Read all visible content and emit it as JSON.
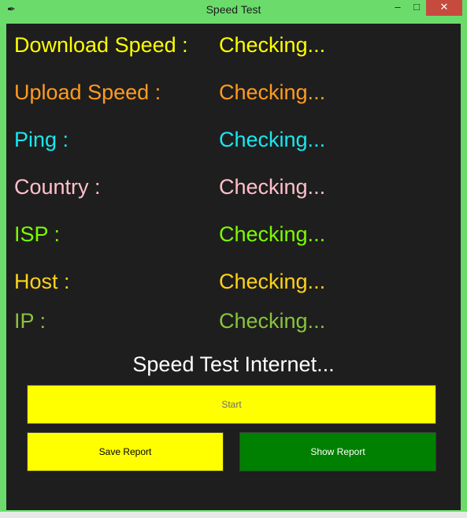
{
  "window": {
    "title": "Speed Test",
    "icon": "feather-icon",
    "minimize_glyph": "–",
    "maximize_glyph": "□",
    "close_glyph": "✕"
  },
  "rows": [
    {
      "label": "Download Speed :",
      "value": "Checking...",
      "color": "#ffff00"
    },
    {
      "label": "Upload Speed :",
      "value": "Checking...",
      "color": "#ff9b21"
    },
    {
      "label": "Ping :",
      "value": "Checking...",
      "color": "#1ae6ee"
    },
    {
      "label": "Country :",
      "value": "Checking...",
      "color": "#ffc0cb"
    },
    {
      "label": "ISP :",
      "value": "Checking...",
      "color": "#7cfc00"
    },
    {
      "label": "Host :",
      "value": "Checking...",
      "color": "#ffd21a"
    },
    {
      "label": "IP :",
      "value": "Checking...",
      "color": "#8ac43a"
    }
  ],
  "heading": "Speed Test Internet...",
  "buttons": {
    "start": "Start",
    "save_report": "Save Report",
    "show_report": "Show Report"
  },
  "colors": {
    "frame": "#6bdc6b",
    "client_bg": "#1e1e1e",
    "start_bg": "#ffff00",
    "save_bg": "#ffff00",
    "show_bg": "#008000"
  }
}
